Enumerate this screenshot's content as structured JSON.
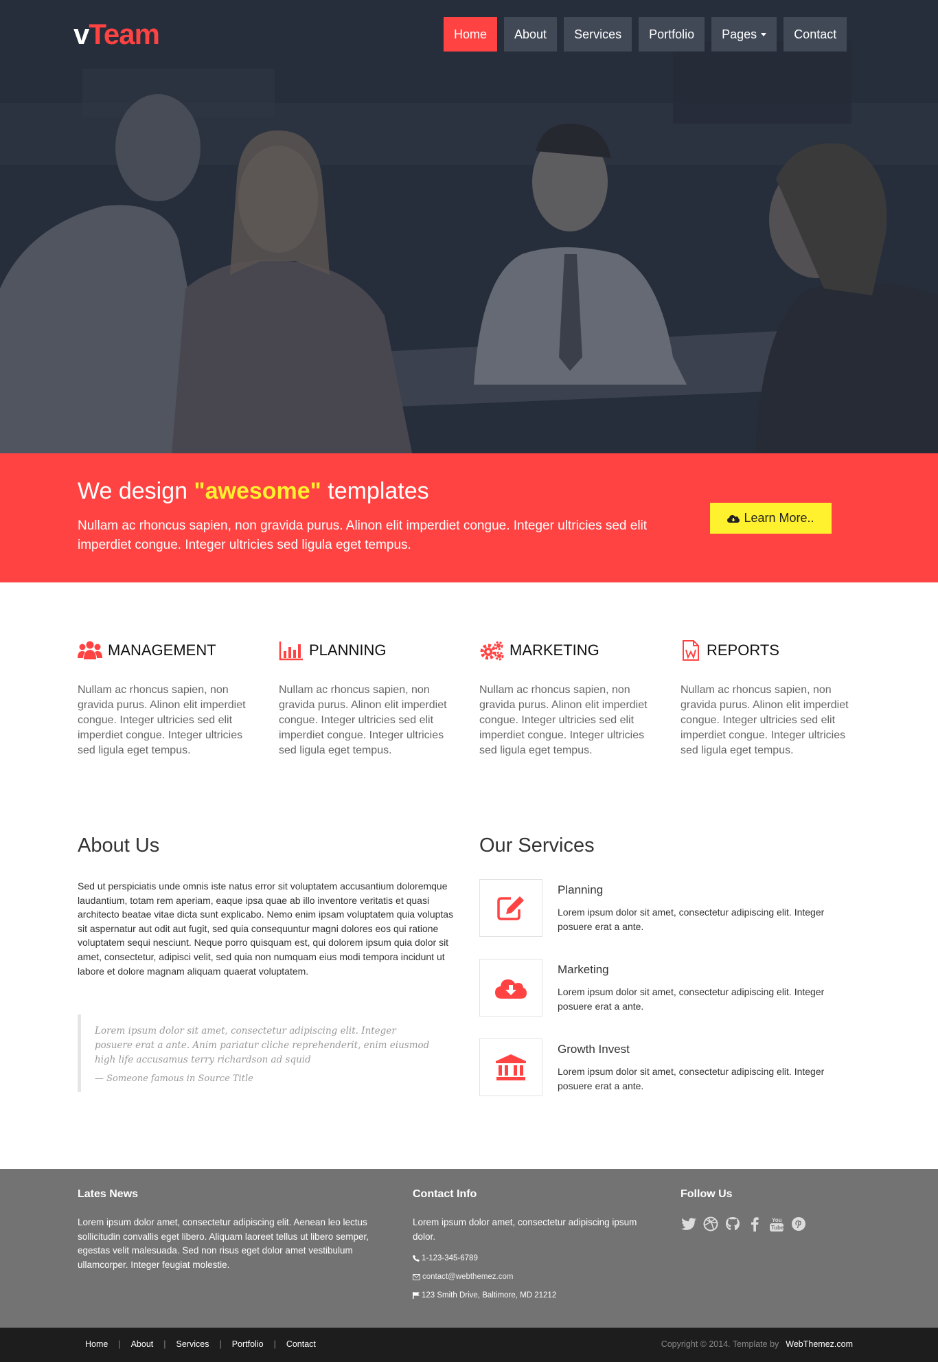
{
  "brand": {
    "prefix": "v",
    "name": "Team"
  },
  "nav": {
    "items": [
      {
        "label": "Home",
        "active": true
      },
      {
        "label": "About"
      },
      {
        "label": "Services"
      },
      {
        "label": "Portfolio"
      },
      {
        "label": "Pages"
      },
      {
        "label": "Contact"
      }
    ]
  },
  "callout": {
    "title_pre": "We design ",
    "title_highlight": "\"awesome\"",
    "title_post": " templates",
    "text": "Nullam ac rhoncus sapien, non gravida purus. Alinon elit imperdiet congue. Integer ultricies sed elit imperdiet congue. Integer ultricies sed ligula eget tempus.",
    "button_label": "Learn More.."
  },
  "features": [
    {
      "icon": "users-icon",
      "title": "MANAGEMENT",
      "text": "Nullam ac rhoncus sapien, non gravida purus. Alinon elit imperdiet congue. Integer ultricies sed elit imperdiet congue. Integer ultricies sed ligula eget tempus."
    },
    {
      "icon": "bar-chart-icon",
      "title": "PLANNING",
      "text": "Nullam ac rhoncus sapien, non gravida purus. Alinon elit imperdiet congue. Integer ultricies sed elit imperdiet congue. Integer ultricies sed ligula eget tempus."
    },
    {
      "icon": "gears-icon",
      "title": "MARKETING",
      "text": "Nullam ac rhoncus sapien, non gravida purus. Alinon elit imperdiet congue. Integer ultricies sed elit imperdiet congue. Integer ultricies sed ligula eget tempus."
    },
    {
      "icon": "word-file-icon",
      "title": "REPORTS",
      "text": "Nullam ac rhoncus sapien, non gravida purus. Alinon elit imperdiet congue. Integer ultricies sed elit imperdiet congue. Integer ultricies sed ligula eget tempus."
    }
  ],
  "about": {
    "title": "About Us",
    "text": "Sed ut perspiciatis unde omnis iste natus error sit voluptatem accusantium doloremque laudantium, totam rem aperiam, eaque ipsa quae ab illo inventore veritatis et quasi architecto beatae vitae dicta sunt explicabo. Nemo enim ipsam voluptatem quia voluptas sit aspernatur aut odit aut fugit, sed quia consequuntur magni dolores eos qui ratione voluptatem sequi nesciunt. Neque porro quisquam est, qui dolorem ipsum quia dolor sit amet, consectetur, adipisci velit, sed quia non numquam eius modi tempora incidunt ut labore et dolore magnam aliquam quaerat voluptatem.",
    "quote": "Lorem ipsum dolor sit amet, consectetur adipiscing elit. Integer posuere erat a ante. Anim pariatur cliche reprehenderit, enim eiusmod high life accusamus terry richardson ad squid",
    "quote_source": "— Someone famous in Source Title"
  },
  "services": {
    "title": "Our Services",
    "items": [
      {
        "icon": "edit-icon",
        "title": "Planning",
        "text": "Lorem ipsum dolor sit amet, consectetur adipiscing elit. Integer posuere erat a ante."
      },
      {
        "icon": "cloud-download-icon",
        "title": "Marketing",
        "text": "Lorem ipsum dolor sit amet, consectetur adipiscing elit. Integer posuere erat a ante."
      },
      {
        "icon": "bank-icon",
        "title": "Growth Invest",
        "text": "Lorem ipsum dolor sit amet, consectetur adipiscing elit. Integer posuere erat a ante."
      }
    ]
  },
  "footer": {
    "news_title": "Lates News",
    "news_text": "Lorem ipsum dolor amet, consectetur adipiscing elit. Aenean leo lectus sollicitudin convallis eget libero. Aliquam laoreet tellus ut libero semper, egestas velit malesuada. Sed non risus eget dolor amet vestibulum ullamcorper. Integer feugiat molestie.",
    "contact_title": "Contact Info",
    "contact_text": "Lorem ipsum dolor amet, consectetur adipiscing ipsum dolor.",
    "phone": "1-123-345-6789",
    "email": "contact@webthemez.com",
    "address": "123 Smith Drive, Baltimore, MD 21212",
    "follow_title": "Follow Us",
    "social": [
      "twitter-icon",
      "dribbble-icon",
      "github-icon",
      "facebook-icon",
      "youtube-icon",
      "pinterest-icon"
    ]
  },
  "bottom": {
    "links": [
      "Home",
      "About",
      "Services",
      "Portfolio",
      "Contact"
    ],
    "copyright": "Copyright © 2014. Template by",
    "credit": "WebThemez.com"
  },
  "colors": {
    "accent": "#ff4343",
    "highlight": "#fff12e",
    "footer": "#737373",
    "bottom_bar": "#1d1d1d"
  }
}
